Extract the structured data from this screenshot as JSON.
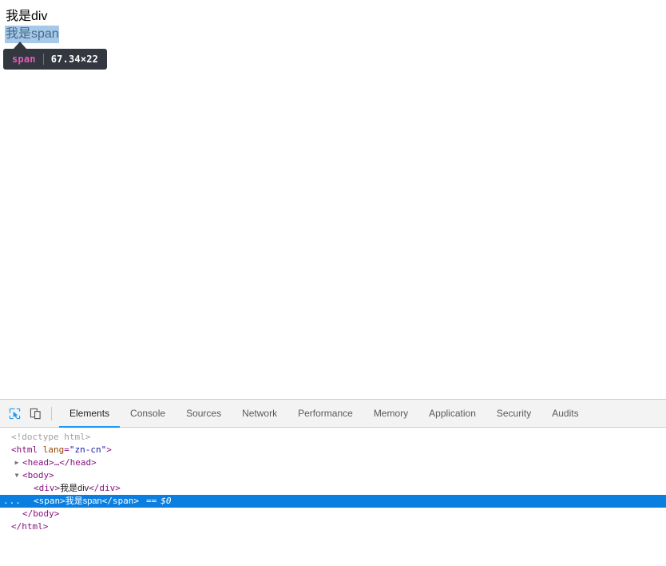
{
  "viewport": {
    "div_text": "我是div",
    "span_text": "我是span",
    "highlight_color": "#6fa8dc"
  },
  "tooltip": {
    "tag_label": "span",
    "separator": "|",
    "dimensions": "67.34×22",
    "background": "#333740",
    "tag_color": "#e75ab5"
  },
  "devtools": {
    "toolbar": {
      "inspect_icon": "inspect-element-icon",
      "device_icon": "device-toolbar-icon",
      "accent": "#1a9af5"
    },
    "tabs": [
      {
        "label": "Elements",
        "active": true
      },
      {
        "label": "Console",
        "active": false
      },
      {
        "label": "Sources",
        "active": false
      },
      {
        "label": "Network",
        "active": false
      },
      {
        "label": "Performance",
        "active": false
      },
      {
        "label": "Memory",
        "active": false
      },
      {
        "label": "Application",
        "active": false
      },
      {
        "label": "Security",
        "active": false
      },
      {
        "label": "Audits",
        "active": false
      }
    ],
    "dom": {
      "doctype": "<!doctype html>",
      "html_open_lt": "<",
      "html_tag": "html",
      "html_attr_name": "lang",
      "html_attr_eq": "=",
      "html_attr_value": "\"zn-cn\"",
      "html_open_gt": ">",
      "head_row": "<head>…</head>",
      "head_triangle": "▶",
      "body_open": "<body>",
      "body_triangle": "▼",
      "div_open": "<div>",
      "div_text": "我是div",
      "div_close": "</div>",
      "span_open": "<span>",
      "span_text": "我是span",
      "span_close": "</span>",
      "selected_dots": "...",
      "equals_marker": "==",
      "dollar_zero": "$0",
      "body_close": "</body>",
      "html_close": "</html>",
      "selection_color": "#0b7fe0"
    }
  }
}
